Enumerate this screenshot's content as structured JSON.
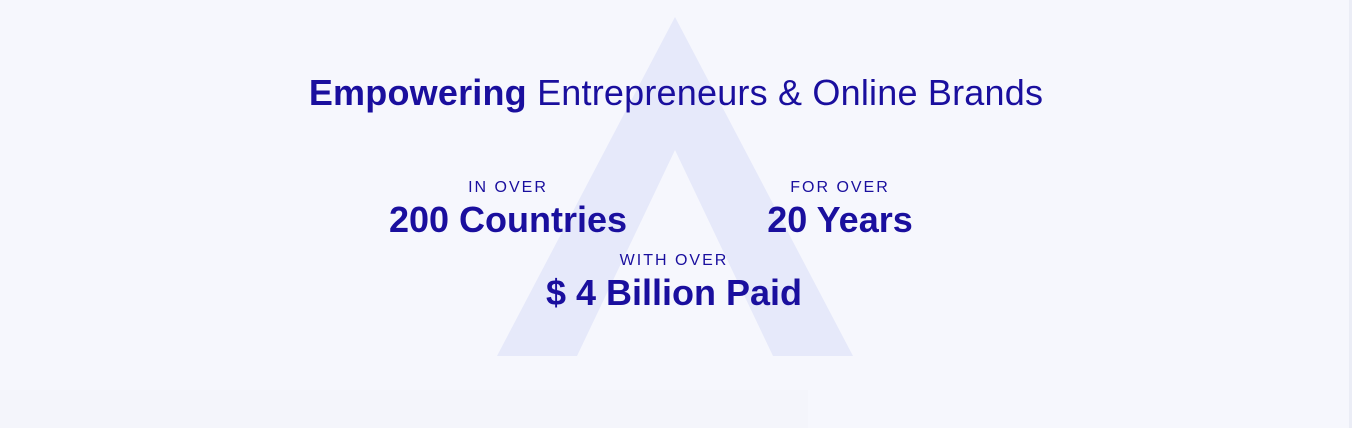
{
  "headline": {
    "emphasis": "Empowering",
    "rest": "Entrepreneurs & Online Brands"
  },
  "stats": [
    {
      "kicker": "IN OVER",
      "value": "200 Countries"
    },
    {
      "kicker": "FOR OVER",
      "value": "20 Years"
    },
    {
      "kicker": "WITH OVER",
      "value": "$ 4 Billion Paid"
    }
  ],
  "colors": {
    "text": "#1a0f9e",
    "background": "#f6f7fd",
    "watermark": "#e6e9fa"
  },
  "icons": {
    "watermark": "triangle-a-logo"
  }
}
